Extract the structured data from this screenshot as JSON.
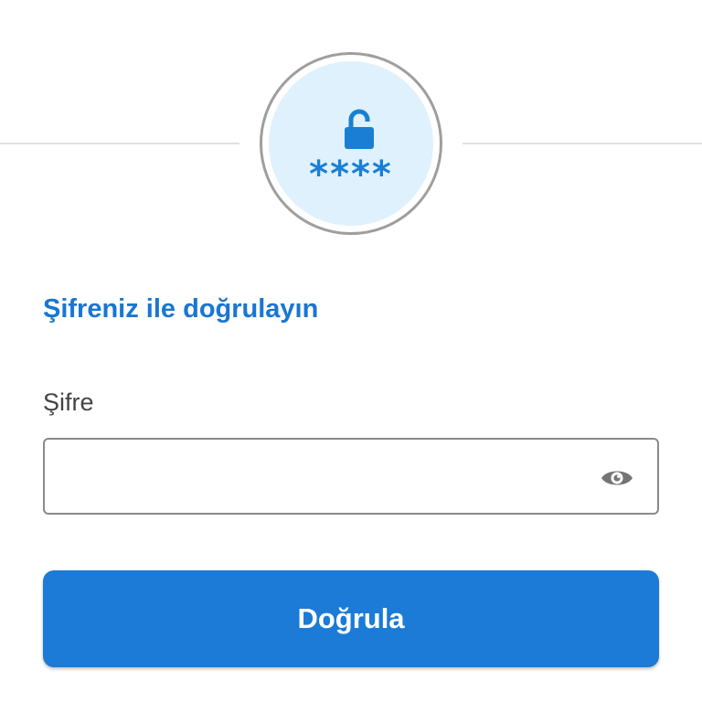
{
  "badge": {
    "lock_icon": "lock-open-icon",
    "asterisks": "****",
    "accent_color": "#1a7fd4"
  },
  "heading": "Şifreniz ile doğrulayın",
  "form": {
    "password_label": "Şifre",
    "password_value": "",
    "password_placeholder": "",
    "toggle_visibility_icon": "eye-icon"
  },
  "submit": {
    "label": "Doğrula",
    "color": "#1b7bd6"
  }
}
